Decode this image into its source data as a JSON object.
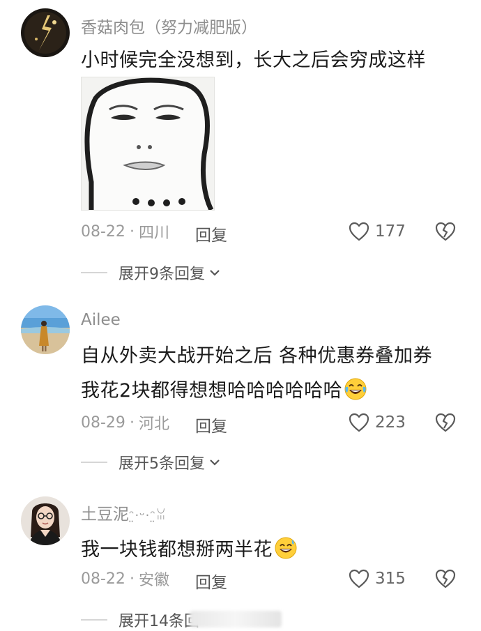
{
  "comments": [
    {
      "username": "香菇肉包（努力减肥版）",
      "lines": [
        "小时候完全没想到，长大之后会穷成这样"
      ],
      "date": "08-22",
      "location": "四川",
      "reply_label": "回复",
      "likes": "177",
      "expand_label": "展开9条回复",
      "has_image": true
    },
    {
      "username": "Ailee",
      "lines": [
        "自从外卖大战开始之后  各种优惠券叠加券",
        "我花2块都得想想哈哈哈哈哈哈"
      ],
      "date": "08-29",
      "location": "河北",
      "reply_label": "回复",
      "likes": "223",
      "expand_label": "展开5条回复",
      "emoji": "laughing-tears"
    },
    {
      "username": "土豆泥",
      "lines": [
        "我一块钱都想掰两半花"
      ],
      "date": "08-22",
      "location": "安徽",
      "reply_label": "回复",
      "likes": "315",
      "expand_label": "展开14条回",
      "emoji": "grinning-sweat"
    }
  ],
  "colors": {
    "text": "#1b1b1b",
    "muted": "#9a9a9a",
    "username": "#8e8e8e",
    "divider": "#d6d6d6"
  },
  "icons": [
    "heart-icon",
    "broken-heart-icon",
    "chevron-down-icon"
  ]
}
